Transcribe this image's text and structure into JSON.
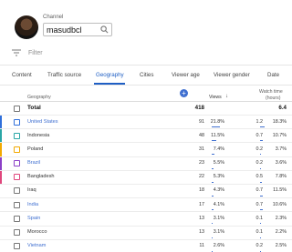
{
  "channel": {
    "label": "Channel",
    "name": "masudbcl"
  },
  "filter": {
    "placeholder": "Filter"
  },
  "tabs": [
    "Content",
    "Traffic source",
    "Geography",
    "Cities",
    "Viewer age",
    "Viewer gender",
    "Date"
  ],
  "active_tab": "Geography",
  "accent": "#1f5fc4",
  "table": {
    "col_geo": "Geography",
    "col_views": "Views",
    "col_wt": "Watch time",
    "col_wt_unit": "(hours)",
    "total": {
      "label": "Total",
      "views": "418",
      "wt": "6.4"
    },
    "rows": [
      {
        "name": "United States",
        "views": "91",
        "pct": "21.8%",
        "wt": "1.2",
        "wtp": "18.3%",
        "color": "#2f6fdb",
        "link": true
      },
      {
        "name": "Indonesia",
        "views": "48",
        "pct": "11.5%",
        "wt": "0.7",
        "wtp": "10.7%",
        "color": "#2aa6a6",
        "link": false
      },
      {
        "name": "Poland",
        "views": "31",
        "pct": "7.4%",
        "wt": "0.2",
        "wtp": "3.7%",
        "color": "#f2a900",
        "link": false
      },
      {
        "name": "Brazil",
        "views": "23",
        "pct": "5.5%",
        "wt": "0.2",
        "wtp": "3.6%",
        "color": "#8b3fc7",
        "link": true
      },
      {
        "name": "Bangladesh",
        "views": "22",
        "pct": "5.3%",
        "wt": "0.5",
        "wtp": "7.8%",
        "color": "#e0467c",
        "link": false
      },
      {
        "name": "Iraq",
        "views": "18",
        "pct": "4.3%",
        "wt": "0.7",
        "wtp": "11.5%",
        "color": "",
        "link": false
      },
      {
        "name": "India",
        "views": "17",
        "pct": "4.1%",
        "wt": "0.7",
        "wtp": "10.6%",
        "color": "",
        "link": true
      },
      {
        "name": "Spain",
        "views": "13",
        "pct": "3.1%",
        "wt": "0.1",
        "wtp": "2.3%",
        "color": "",
        "link": true
      },
      {
        "name": "Morocco",
        "views": "13",
        "pct": "3.1%",
        "wt": "0.1",
        "wtp": "2.2%",
        "color": "",
        "link": false
      },
      {
        "name": "Vietnam",
        "views": "11",
        "pct": "2.6%",
        "wt": "0.2",
        "wtp": "2.5%",
        "color": "",
        "link": true
      }
    ]
  }
}
